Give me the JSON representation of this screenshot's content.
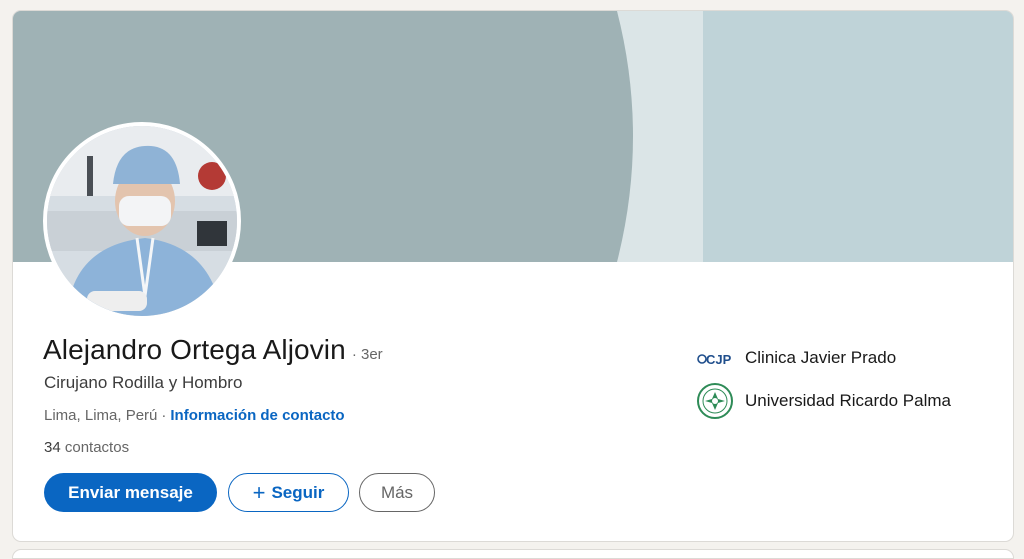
{
  "profile": {
    "name": "Alejandro Ortega Aljovin",
    "degree": "· 3er",
    "headline": "Cirujano Rodilla y Hombro",
    "location": "Lima, Lima, Perú",
    "location_separator": "·",
    "contact_info_link": "Información de contacto",
    "connections_count": "34",
    "connections_label": "contactos"
  },
  "actions": {
    "message_label": "Enviar mensaje",
    "follow_icon": "+",
    "follow_label": "Seguir",
    "more_label": "Más"
  },
  "organizations": [
    {
      "name": "Clinica Javier Prado",
      "logo": "cjp-logo",
      "logo_text": "CJP"
    },
    {
      "name": "Universidad Ricardo Palma",
      "logo": "urp-seal-logo"
    }
  ],
  "colors": {
    "accent": "#0a66c2",
    "banner_left": "#9fb2b5",
    "banner_mid": "#dbe5e7",
    "banner_right": "#bfd3d8"
  }
}
